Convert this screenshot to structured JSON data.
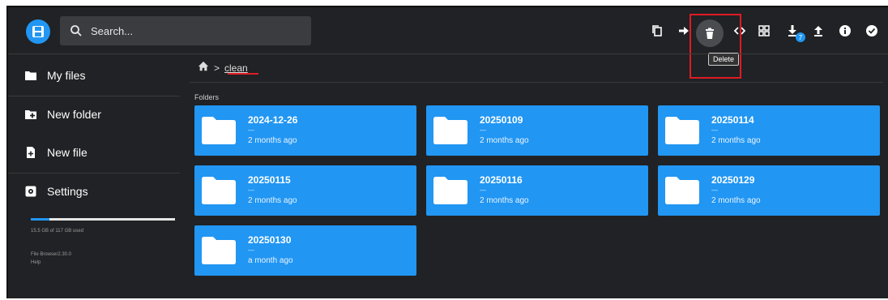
{
  "search": {
    "placeholder": "Search..."
  },
  "toolbar": {
    "icons": [
      "copy-icon",
      "move-icon",
      "delete-icon",
      "code-icon",
      "grid-view-icon",
      "download-icon",
      "upload-icon",
      "info-icon",
      "check-circle-icon"
    ],
    "delete_tooltip": "Delete",
    "download_badge": "7"
  },
  "sidebar": {
    "items": [
      {
        "label": "My files",
        "icon": "folder-icon"
      },
      {
        "label": "New folder",
        "icon": "new-folder-icon"
      },
      {
        "label": "New file",
        "icon": "new-file-icon"
      },
      {
        "label": "Settings",
        "icon": "settings-icon"
      }
    ],
    "usage_text": "15.5 GB of 117 GB used",
    "usage_fraction": 0.13,
    "version": "File Browser2.30.0",
    "help": "Help"
  },
  "breadcrumb": {
    "home_icon": "home-icon",
    "separator": ">",
    "current": "clean"
  },
  "section_label": "Folders",
  "folders": [
    {
      "name": "2024-12-26",
      "dash": "—",
      "modified": "2 months ago"
    },
    {
      "name": "20250109",
      "dash": "—",
      "modified": "2 months ago"
    },
    {
      "name": "20250114",
      "dash": "—",
      "modified": "2 months ago"
    },
    {
      "name": "20250115",
      "dash": "—",
      "modified": "2 months ago"
    },
    {
      "name": "20250116",
      "dash": "—",
      "modified": "2 months ago"
    },
    {
      "name": "20250129",
      "dash": "—",
      "modified": "2 months ago"
    },
    {
      "name": "20250130",
      "dash": "—",
      "modified": "a month ago"
    }
  ],
  "colors": {
    "accent": "#2196f3",
    "background": "#202225",
    "highlight": "#e01b24"
  }
}
